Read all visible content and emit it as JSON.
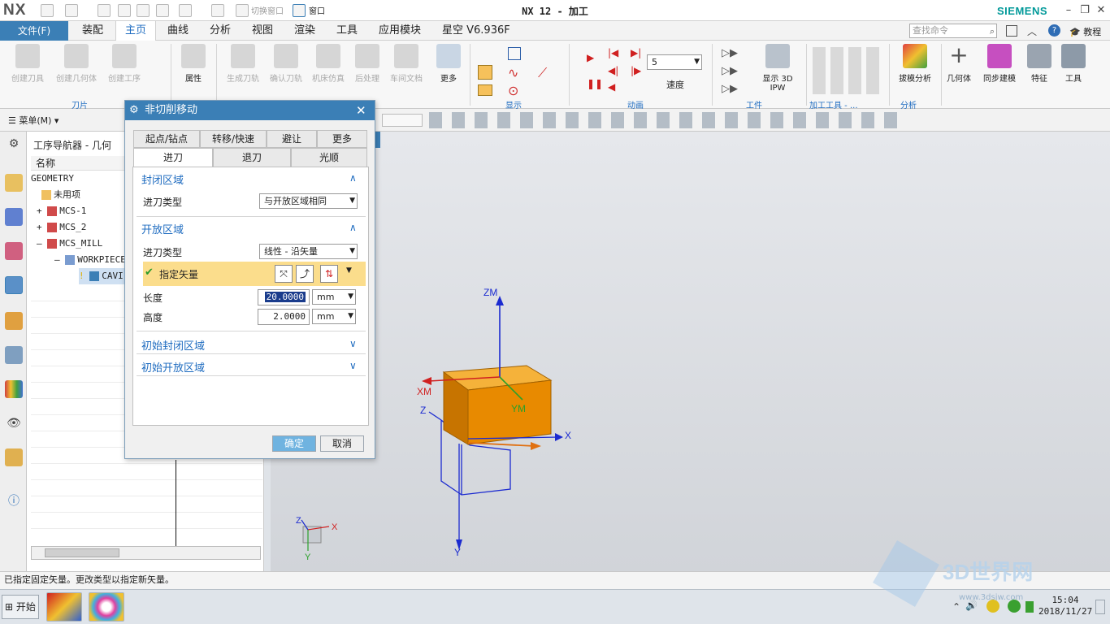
{
  "app": {
    "logo": "NX",
    "title": "NX 12 - 加工",
    "brand": "SIEMENS",
    "quick_switch": "切换窗口",
    "quick_window": "窗口"
  },
  "ribbon_tabs": [
    "文件(F)",
    "装配",
    "主页",
    "曲线",
    "分析",
    "视图",
    "渲染",
    "工具",
    "应用模块",
    "星空 V6.936F"
  ],
  "ribbon_active_tab": "主页",
  "search_placeholder": "查找命令",
  "help_label": "教程",
  "ribbon": {
    "insert": [
      "创建刀具",
      "创建几何体",
      "创建工序"
    ],
    "attr": "属性",
    "ops": [
      "生成刀轨",
      "确认刀轨",
      "机床仿真",
      "后处理",
      "车间文档"
    ],
    "more": "更多",
    "speed_value": "5",
    "speed_label": "速度",
    "ipw": "显示 3D IPW",
    "geom_analysis": "拔模分析",
    "body": "几何体",
    "sync": "同步建模",
    "feature": "特征",
    "tools": "工具",
    "groups": [
      "刀片",
      "显示",
      "动画",
      "工件",
      "加工工具 - ...",
      "分析"
    ]
  },
  "selbar": {
    "menu": "菜单(M)"
  },
  "navigator": {
    "title": "工序导航器 - 几何",
    "column": "名称",
    "root": "GEOMETRY",
    "items": [
      "未用项",
      "MCS-1",
      "MCS_2",
      "MCS_MILL",
      "WORKPIECE",
      "CAVI"
    ]
  },
  "status_text": "已指定固定矢量。更改类型以指定新矢量。",
  "dialog": {
    "title": "非切削移动",
    "tabs_row1": [
      "起点/钻点",
      "转移/快速",
      "避让",
      "更多"
    ],
    "tabs_row2": [
      "进刀",
      "退刀",
      "光顺"
    ],
    "active_tab": "进刀",
    "closed_section": "封闭区域",
    "closed_type_label": "进刀类型",
    "closed_type_value": "与开放区域相同",
    "open_section": "开放区域",
    "open_type_label": "进刀类型",
    "open_type_value": "线性 - 沿矢量",
    "vector_label": "指定矢量",
    "length_label": "长度",
    "length_value": "20.0000",
    "length_unit": "mm",
    "height_label": "高度",
    "height_value": "2.0000",
    "height_unit": "mm",
    "initial_closed": "初始封闭区域",
    "initial_open": "初始开放区域",
    "ok": "确定",
    "cancel": "取消"
  },
  "viewport_labels": {
    "zm": "ZM",
    "xm": "XM",
    "ym": "YM",
    "x": "X",
    "z": "Z",
    "y": "Y",
    "tz": "Z",
    "tx": "X",
    "ty": "Y"
  },
  "taskbar": {
    "start": "开始",
    "time": "15:04",
    "date": "2018/11/27",
    "watermark": "3D世界网",
    "watermark_url": "www.3dsjw.com"
  },
  "colors": {
    "accent": "#3b7fb6",
    "highlight": "#fbdd8c",
    "block": "#e88a00"
  }
}
